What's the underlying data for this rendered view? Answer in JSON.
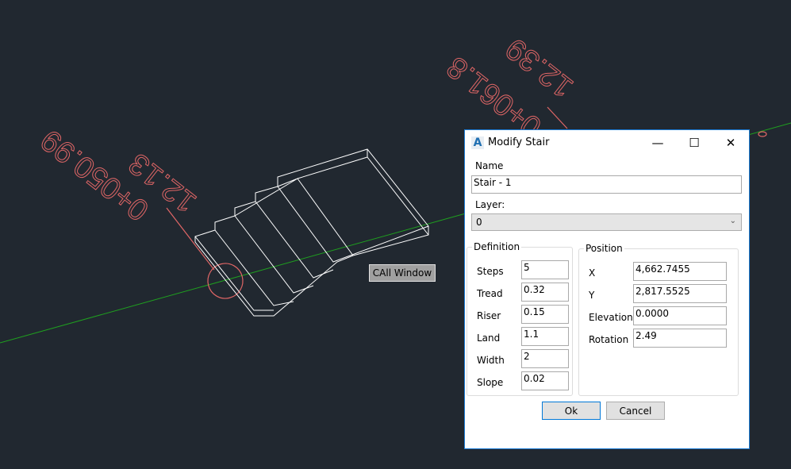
{
  "cad": {
    "labels": [
      {
        "line1": "12.13",
        "line2": "0+050.99"
      },
      {
        "line1": "12.39",
        "line2": "0+061.8"
      }
    ],
    "colors": {
      "background": "#212830",
      "text": "#e06666",
      "axis": "#1fa01f",
      "wireframe": "#ffffff"
    },
    "tooltip": "CAll Window"
  },
  "dialog": {
    "title": "Modify Stair",
    "icon": "autocad-logo-icon",
    "name_label": "Name",
    "name_value": "Stair - 1",
    "layer_label": "Layer:",
    "layer_value": "0",
    "definition": {
      "title": "Definition",
      "fields": [
        {
          "label": "Steps",
          "value": "5"
        },
        {
          "label": "Tread",
          "value": "0.32"
        },
        {
          "label": "Riser",
          "value": "0.15"
        },
        {
          "label": "Land",
          "value": "1.1"
        },
        {
          "label": "Width",
          "value": "2"
        },
        {
          "label": "Slope",
          "value": "0.02"
        }
      ]
    },
    "position": {
      "title": "Position",
      "fields": [
        {
          "label": "X",
          "value": "4,662.7455"
        },
        {
          "label": "Y",
          "value": "2,817.5525"
        },
        {
          "label": "Elevation",
          "value": "0.0000"
        },
        {
          "label": "Rotation",
          "value": "2.49"
        }
      ]
    },
    "ok": "Ok",
    "cancel": "Cancel"
  }
}
